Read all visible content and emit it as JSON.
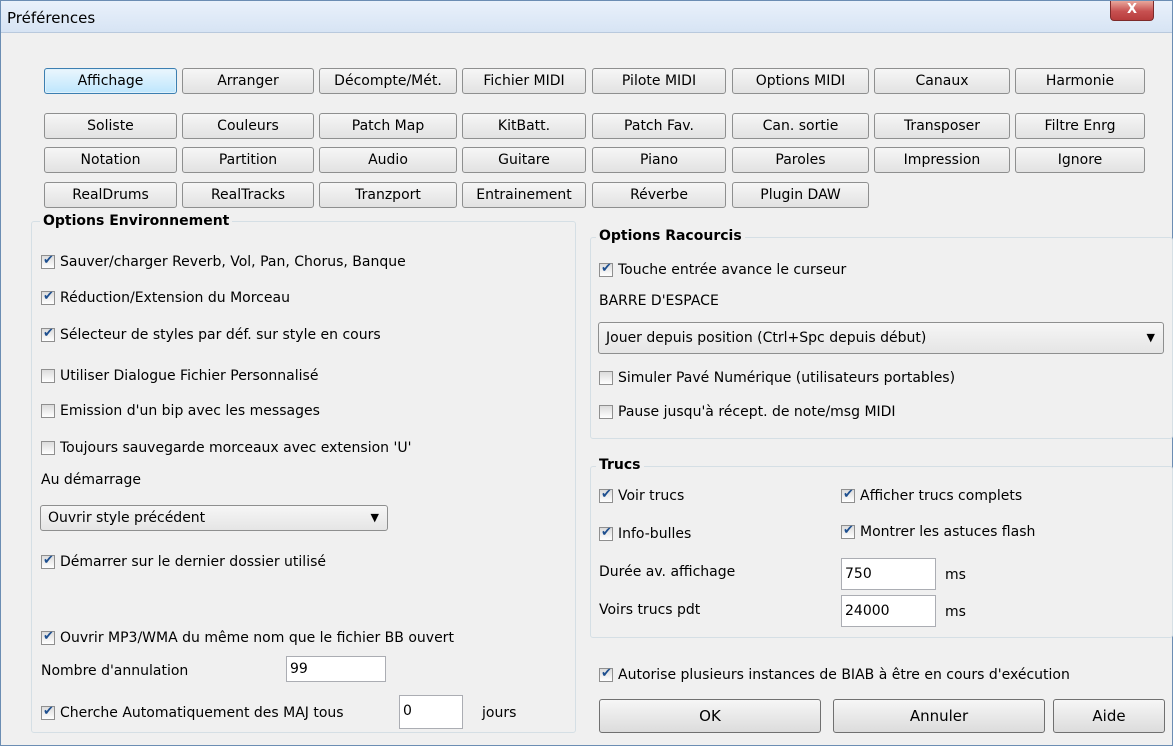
{
  "window": {
    "title": "Préférences",
    "close_label": "X"
  },
  "tabs": {
    "row1": [
      "Affichage",
      "Arranger",
      "Décompte/Mét.",
      "Fichier MIDI",
      "Pilote MIDI",
      "Options MIDI",
      "Canaux",
      "Harmonie"
    ],
    "row2": [
      "Soliste",
      "Couleurs",
      "Patch Map",
      "KitBatt.",
      "Patch Fav.",
      "Can. sortie",
      "Transposer",
      "Filtre Enrg"
    ],
    "row3": [
      "Notation",
      "Partition",
      "Audio",
      "Guitare",
      "Piano",
      "Paroles",
      "Impression",
      "Ignore"
    ],
    "row4": [
      "RealDrums",
      "RealTracks",
      "Tranzport",
      "Entrainement",
      "Réverbe",
      "Plugin DAW"
    ],
    "active": "Affichage"
  },
  "env": {
    "title": "Options Environnement",
    "cb1": "Sauver/charger Reverb, Vol, Pan, Chorus, Banque",
    "cb2": "Réduction/Extension du Morceau",
    "cb3": "Sélecteur de styles par déf. sur style en cours",
    "cb4": "Utiliser Dialogue Fichier Personnalisé",
    "cb5": "Emission d'un bip avec les messages",
    "cb6": "Toujours sauvegarde morceaux avec extension 'U'",
    "startup_label": "Au démarrage",
    "startup_value": "Ouvrir style précédent",
    "cb7": "Démarrer sur le dernier dossier utilisé",
    "cb8": "Ouvrir MP3/WMA du même nom que le fichier BB ouvert",
    "undo_label": "Nombre d'annulation",
    "undo_value": "99",
    "cb9": "Cherche Automatiquement des MAJ tous",
    "update_days": "0",
    "days_unit": "jours"
  },
  "shortcuts": {
    "title": "Options Racourcis",
    "cb1": "Touche entrée avance le curseur",
    "space_label": "BARRE D'ESPACE",
    "space_value": "Jouer depuis position (Ctrl+Spc depuis début)",
    "cb2": "Simuler Pavé Numérique (utilisateurs portables)",
    "cb3": "Pause jusqu'à récept. de note/msg MIDI"
  },
  "tips": {
    "title": "Trucs",
    "cb1": "Voir trucs",
    "cb2": "Afficher trucs complets",
    "cb3": "Info-bulles",
    "cb4": "Montrer les astuces flash",
    "delay_label": "Durée av. affichage",
    "delay_value": "750",
    "show_label": "Voirs trucs pdt",
    "show_value": "24000",
    "unit": "ms"
  },
  "multi_instance": "Autorise plusieurs instances de BIAB à être en cours d'exécution",
  "buttons": {
    "ok": "OK",
    "cancel": "Annuler",
    "help": "Aide"
  }
}
